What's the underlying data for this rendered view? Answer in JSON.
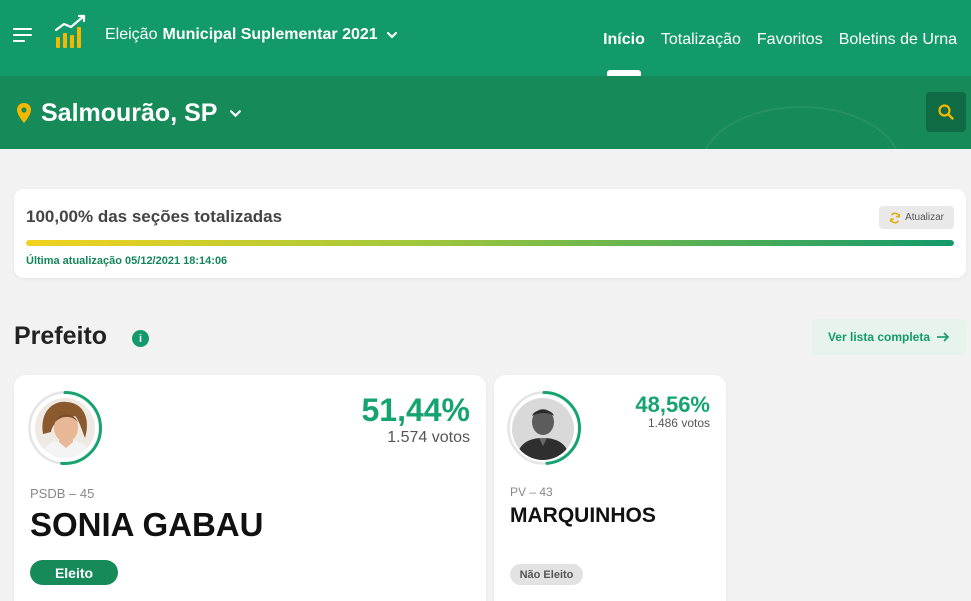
{
  "header": {
    "election_prefix": "Eleição",
    "election_title": "Municipal Suplementar 2021",
    "nav": [
      {
        "label": "Início",
        "active": true
      },
      {
        "label": "Totalização",
        "active": false
      },
      {
        "label": "Favoritos",
        "active": false
      },
      {
        "label": "Boletins de Urna",
        "active": false
      }
    ]
  },
  "location": {
    "city": "Salmourão, SP"
  },
  "progress": {
    "title": "100,00% das seções totalizadas",
    "percent": 100,
    "update_button": "Atualizar",
    "last_update": "Última atualização 05/12/2021 18:14:06"
  },
  "section": {
    "title": "Prefeito",
    "info_glyph": "i",
    "full_list_label": "Ver lista completa"
  },
  "candidates": [
    {
      "percentage": "51,44%",
      "percent_value": 51.44,
      "votes": "1.574 votos",
      "party": "PSDB – 45",
      "name": "SONIA GABAU",
      "status": "Eleito"
    },
    {
      "percentage": "48,56%",
      "percent_value": 48.56,
      "votes": "1.486 votos",
      "party": "PV – 43",
      "name": "MARQUINHOS",
      "status": "Não Eleito"
    }
  ],
  "colors": {
    "primary": "#139a6b",
    "dark_green": "#168a59",
    "accent_yellow": "#f5b800",
    "percentage": "#15a36f"
  },
  "icons": [
    "menu-icon",
    "chart-logo-icon",
    "chevron-down-icon",
    "location-pin-icon",
    "search-icon",
    "refresh-icon",
    "info-icon",
    "arrow-right-icon"
  ]
}
